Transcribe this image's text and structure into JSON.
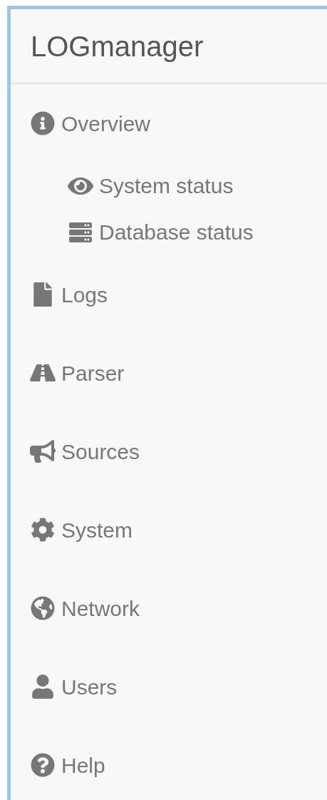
{
  "brand": "LOGmanager",
  "nav": [
    {
      "label": "Overview",
      "children": [
        {
          "label": "System status"
        },
        {
          "label": "Database status"
        }
      ]
    },
    {
      "label": "Logs"
    },
    {
      "label": "Parser"
    },
    {
      "label": "Sources"
    },
    {
      "label": "System"
    },
    {
      "label": "Network"
    },
    {
      "label": "Users"
    },
    {
      "label": "Help"
    }
  ]
}
